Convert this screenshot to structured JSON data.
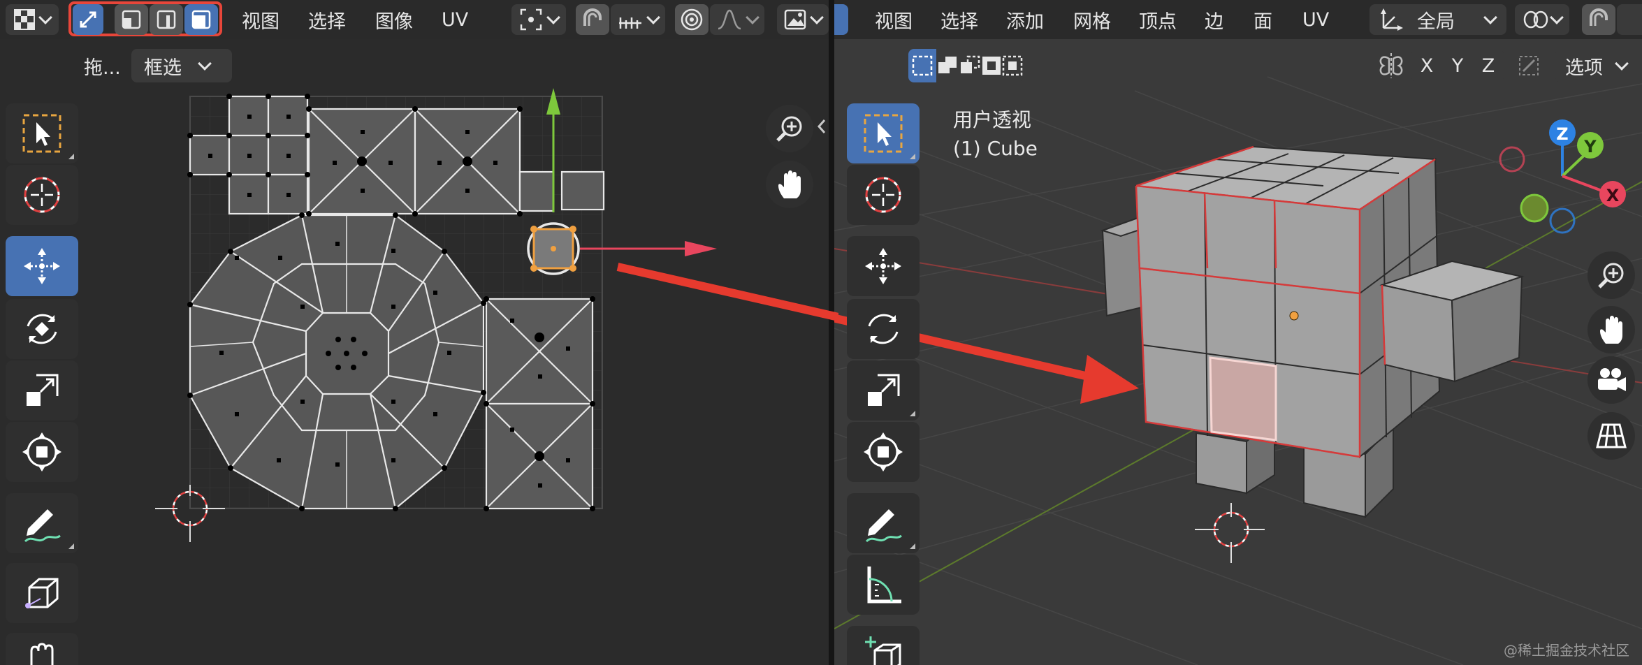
{
  "uv_editor": {
    "header": {
      "menus": [
        {
          "name": "view",
          "label": "视图"
        },
        {
          "name": "select",
          "label": "选择"
        },
        {
          "name": "image",
          "label": "图像"
        },
        {
          "name": "uv",
          "label": "UV"
        }
      ]
    },
    "subheader": {
      "drag_label": "拖...",
      "select_mode": "框选"
    }
  },
  "viewport": {
    "header": {
      "menus": [
        {
          "name": "view",
          "label": "视图"
        },
        {
          "name": "select",
          "label": "选择"
        },
        {
          "name": "add",
          "label": "添加"
        },
        {
          "name": "mesh",
          "label": "网格"
        },
        {
          "name": "vertex",
          "label": "顶点"
        },
        {
          "name": "edge",
          "label": "边"
        },
        {
          "name": "face",
          "label": "面"
        },
        {
          "name": "uv",
          "label": "UV"
        }
      ],
      "transform_orientation": "全局"
    },
    "subheader": {
      "axes": [
        "X",
        "Y",
        "Z"
      ],
      "options_label": "选项"
    },
    "overlay": {
      "view_name": "用户透视",
      "object_name": "(1) Cube"
    },
    "gizmo": {
      "x": "X",
      "y": "Y",
      "z": "Z"
    }
  },
  "watermark": "@稀土掘金技术社区",
  "colors": {
    "accent": "#4772b3",
    "highlight_box": "#e8463a",
    "arrow": "#e63a2e",
    "x_axis": "#e8465e",
    "y_axis": "#7ec83c",
    "z_axis": "#2d82e3"
  }
}
